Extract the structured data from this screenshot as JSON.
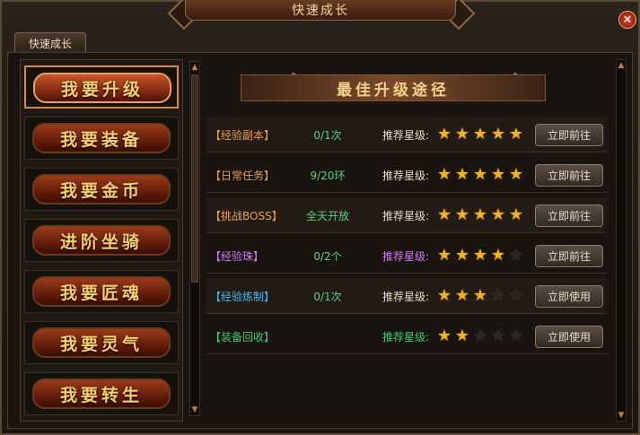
{
  "window": {
    "title": "快速成长"
  },
  "tabs": [
    {
      "label": "快速成长"
    }
  ],
  "menu": {
    "items": [
      {
        "label": "我要升级",
        "active": true
      },
      {
        "label": "我要装备",
        "active": false
      },
      {
        "label": "我要金币",
        "active": false
      },
      {
        "label": "进阶坐骑",
        "active": false
      },
      {
        "label": "我要匠魂",
        "active": false
      },
      {
        "label": "我要灵气",
        "active": false
      },
      {
        "label": "我要转生",
        "active": false
      }
    ]
  },
  "panel": {
    "banner": "最佳升级途径",
    "rows": [
      {
        "name": "【经验副本】",
        "name_color": "#e8a050",
        "count": "0/1次",
        "rec_label": "推荐星级:",
        "rec_color": "#e8dcc8",
        "stars": 5,
        "button": "立即前往"
      },
      {
        "name": "【日常任务】",
        "name_color": "#e8a050",
        "count": "9/20环",
        "rec_label": "推荐星级:",
        "rec_color": "#e8dcc8",
        "stars": 5,
        "button": "立即前往"
      },
      {
        "name": "【挑战BOSS】",
        "name_color": "#e8a050",
        "count": "全天开放",
        "rec_label": "推荐星级:",
        "rec_color": "#e8dcc8",
        "stars": 5,
        "button": "立即前往"
      },
      {
        "name": "【经验珠】",
        "name_color": "#d27cf0",
        "count": "0/2个",
        "rec_label": "推荐星级:",
        "rec_color": "#d27cf0",
        "stars": 4,
        "button": "立即前往"
      },
      {
        "name": "【经验炼制】",
        "name_color": "#4ab8f0",
        "count": "0/1次",
        "rec_label": "推荐星级:",
        "rec_color": "#e8dcc8",
        "stars": 3,
        "button": "立即使用"
      },
      {
        "name": "【装备回收】",
        "name_color": "#3cc87a",
        "count": "",
        "rec_label": "推荐星级:",
        "rec_color": "#3cc87a",
        "stars": 2,
        "button": "立即使用"
      }
    ],
    "count_color": "#5fd07a",
    "max_stars": 5
  }
}
